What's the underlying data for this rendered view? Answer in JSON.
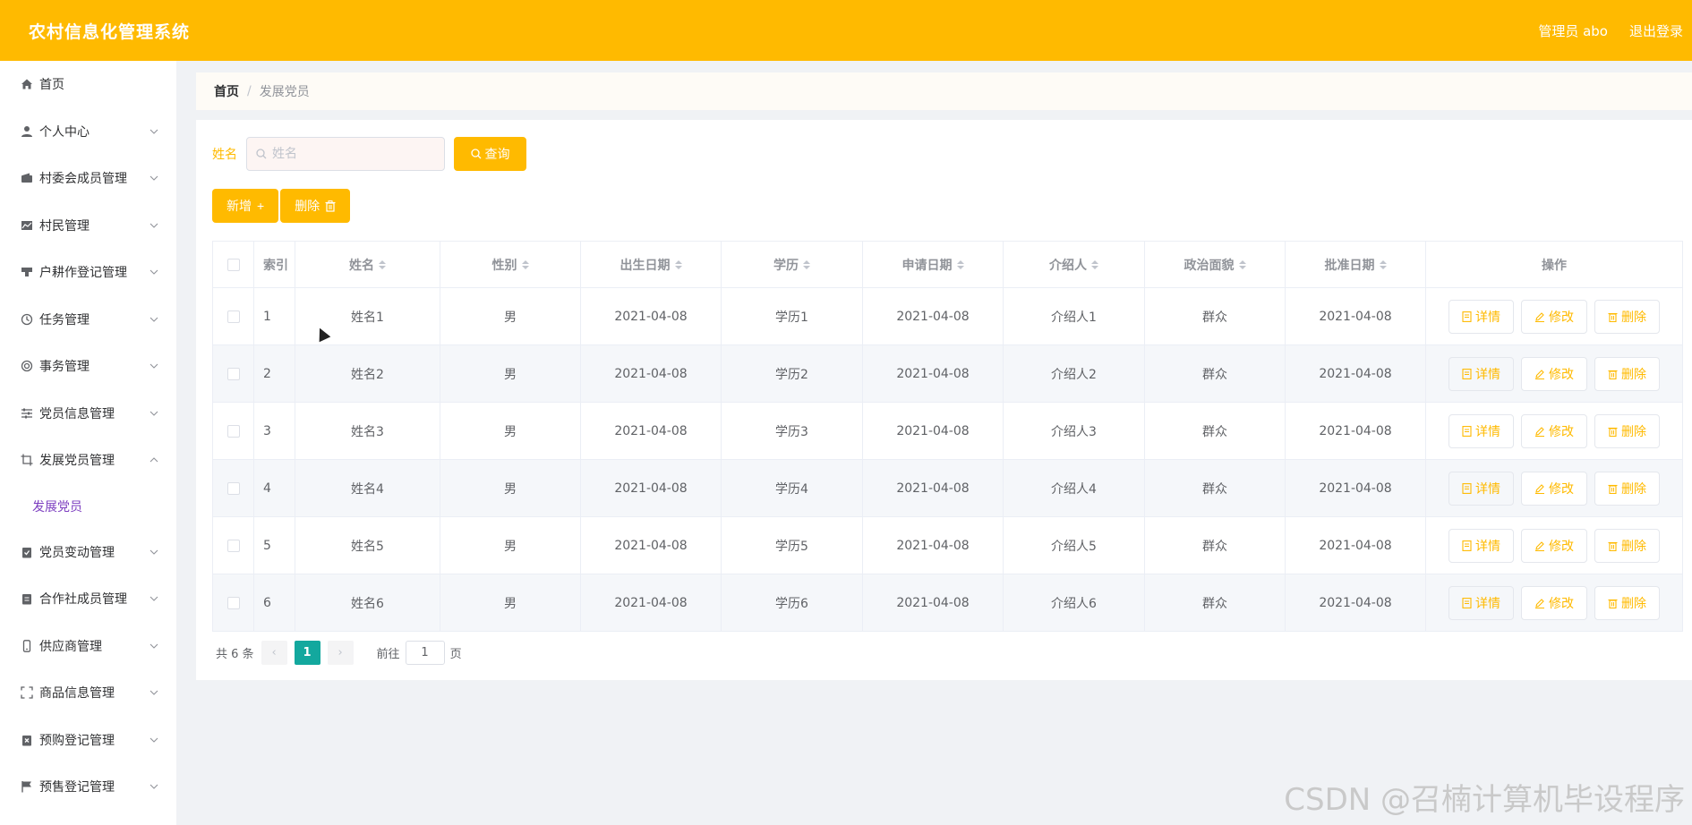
{
  "header": {
    "app_title": "农村信息化管理系统",
    "user_label": "管理员 abo",
    "logout_label": "退出登录"
  },
  "sidebar": {
    "items": [
      {
        "label": "首页",
        "icon": "home-icon",
        "expandable": false
      },
      {
        "label": "个人中心",
        "icon": "user-icon",
        "expandable": true
      },
      {
        "label": "村委会成员管理",
        "icon": "wallet-icon",
        "expandable": true
      },
      {
        "label": "村民管理",
        "icon": "chart-icon",
        "expandable": true
      },
      {
        "label": "户耕作登记管理",
        "icon": "stamp-icon",
        "expandable": true
      },
      {
        "label": "任务管理",
        "icon": "clock-icon",
        "expandable": true
      },
      {
        "label": "事务管理",
        "icon": "lifebuoy-icon",
        "expandable": true
      },
      {
        "label": "党员信息管理",
        "icon": "sliders-icon",
        "expandable": true
      },
      {
        "label": "发展党员管理",
        "icon": "crop-icon",
        "expandable": true,
        "open": true
      },
      {
        "label": "党员变动管理",
        "icon": "clipboard-check-icon",
        "expandable": true
      },
      {
        "label": "合作社成员管理",
        "icon": "clipboard-icon",
        "expandable": true
      },
      {
        "label": "供应商管理",
        "icon": "phone-icon",
        "expandable": true
      },
      {
        "label": "商品信息管理",
        "icon": "fullscreen-icon",
        "expandable": true
      },
      {
        "label": "预购登记管理",
        "icon": "clipboard-x-icon",
        "expandable": true
      },
      {
        "label": "预售登记管理",
        "icon": "flag-icon",
        "expandable": true
      }
    ],
    "submenu": {
      "label": "发展党员"
    }
  },
  "breadcrumb": {
    "home": "首页",
    "separator": "/",
    "current": "发展党员"
  },
  "search": {
    "label": "姓名",
    "placeholder": "姓名",
    "button": "查询"
  },
  "actions": {
    "add": "新增",
    "add_icon": "plus-icon",
    "delete": "删除",
    "delete_icon": "trash-icon"
  },
  "table": {
    "headers": {
      "index": "索引",
      "name": "姓名",
      "gender": "性别",
      "birth": "出生日期",
      "education": "学历",
      "apply_date": "申请日期",
      "introducer": "介绍人",
      "political": "政治面貌",
      "approve_date": "批准日期",
      "ops": "操作"
    },
    "rows": [
      {
        "index": "1",
        "name": "姓名1",
        "gender": "男",
        "birth": "2021-04-08",
        "education": "学历1",
        "apply_date": "2021-04-08",
        "introducer": "介绍人1",
        "political": "群众",
        "approve_date": "2021-04-08"
      },
      {
        "index": "2",
        "name": "姓名2",
        "gender": "男",
        "birth": "2021-04-08",
        "education": "学历2",
        "apply_date": "2021-04-08",
        "introducer": "介绍人2",
        "political": "群众",
        "approve_date": "2021-04-08"
      },
      {
        "index": "3",
        "name": "姓名3",
        "gender": "男",
        "birth": "2021-04-08",
        "education": "学历3",
        "apply_date": "2021-04-08",
        "introducer": "介绍人3",
        "political": "群众",
        "approve_date": "2021-04-08"
      },
      {
        "index": "4",
        "name": "姓名4",
        "gender": "男",
        "birth": "2021-04-08",
        "education": "学历4",
        "apply_date": "2021-04-08",
        "introducer": "介绍人4",
        "political": "群众",
        "approve_date": "2021-04-08"
      },
      {
        "index": "5",
        "name": "姓名5",
        "gender": "男",
        "birth": "2021-04-08",
        "education": "学历5",
        "apply_date": "2021-04-08",
        "introducer": "介绍人5",
        "political": "群众",
        "approve_date": "2021-04-08"
      },
      {
        "index": "6",
        "name": "姓名6",
        "gender": "男",
        "birth": "2021-04-08",
        "education": "学历6",
        "apply_date": "2021-04-08",
        "introducer": "介绍人6",
        "political": "群众",
        "approve_date": "2021-04-08"
      }
    ],
    "row_ops": {
      "detail": "详情",
      "edit": "修改",
      "delete": "删除"
    }
  },
  "pagination": {
    "total": "共 6 条",
    "current_page": "1",
    "goto_prefix": "前往",
    "goto_value": "1",
    "goto_suffix": "页"
  },
  "watermark": "CSDN @召楠计算机毕设程序",
  "colors": {
    "accent": "#ffba00",
    "active_page": "#13a89e",
    "submenu_active": "#7d3fc0"
  }
}
